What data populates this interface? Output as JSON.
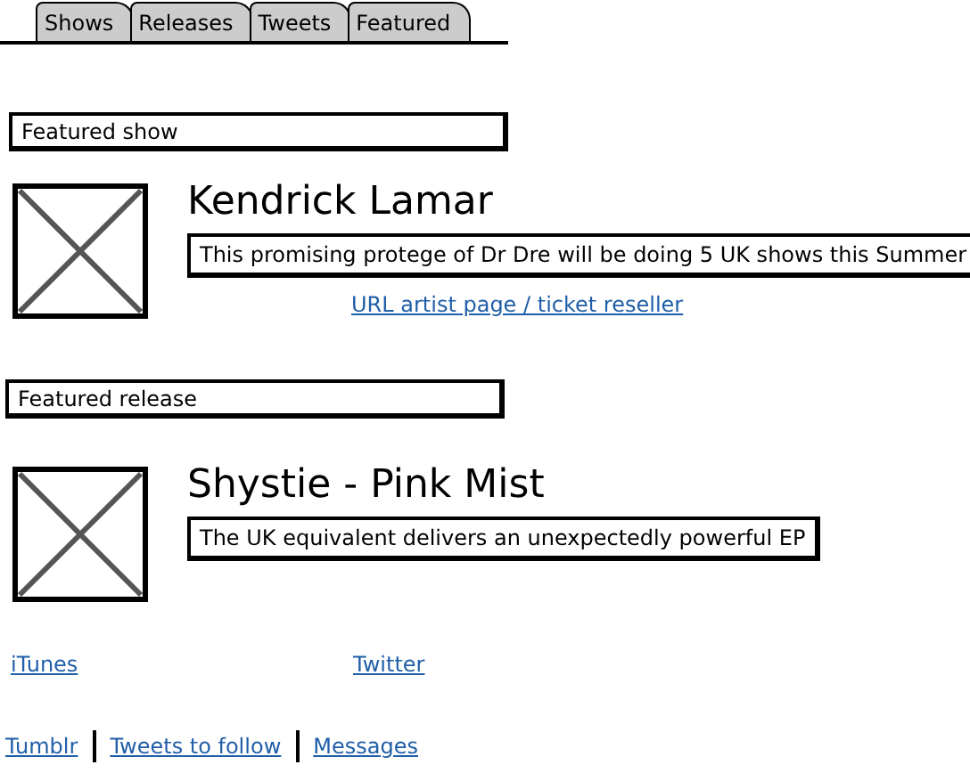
{
  "tabs": [
    {
      "label": "Shows",
      "selected": false
    },
    {
      "label": "Releases",
      "selected": false
    },
    {
      "label": "Tweets",
      "selected": false
    },
    {
      "label": "Featured",
      "selected": false
    }
  ],
  "featured_show": {
    "heading": "Featured show",
    "title": "Kendrick Lamar",
    "description": "This promising protege of Dr Dre will be doing 5 UK shows this Summer",
    "link": "URL artist page / ticket reseller"
  },
  "featured_release": {
    "heading": "Featured release",
    "title": "Shystie - Pink Mist",
    "description": "The UK equivalent delivers an unexpectedly powerful EP"
  },
  "links": [
    "iTunes",
    "Twitter"
  ],
  "footer_links": [
    "Tumblr",
    "Tweets to follow",
    "Messages"
  ]
}
